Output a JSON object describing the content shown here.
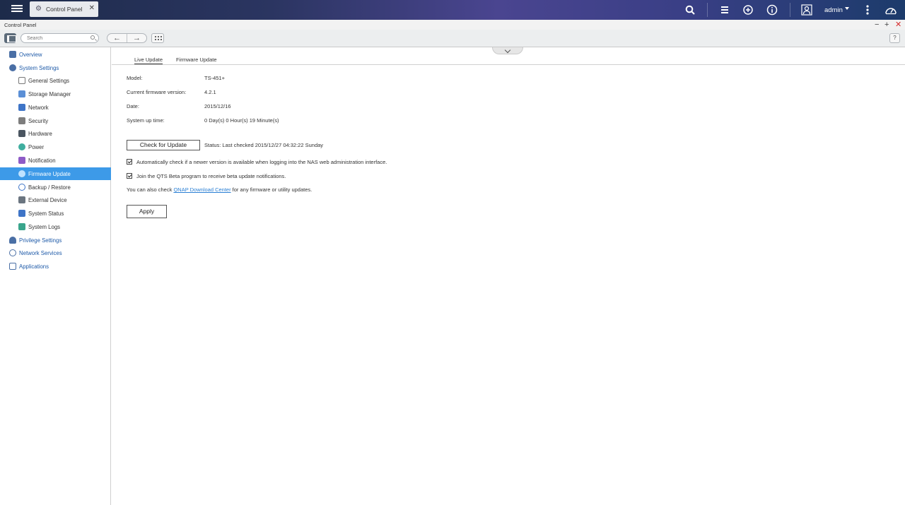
{
  "taskbar": {
    "tab_label": "Control Panel",
    "user_name": "admin"
  },
  "window": {
    "title": "Control Panel"
  },
  "toolbar": {
    "search_placeholder": "Search",
    "help_label": "?"
  },
  "sidebar": {
    "items": [
      {
        "label": "Overview"
      },
      {
        "label": "System Settings"
      },
      {
        "label": "General Settings"
      },
      {
        "label": "Storage Manager"
      },
      {
        "label": "Network"
      },
      {
        "label": "Security"
      },
      {
        "label": "Hardware"
      },
      {
        "label": "Power"
      },
      {
        "label": "Notification"
      },
      {
        "label": "Firmware Update"
      },
      {
        "label": "Backup / Restore"
      },
      {
        "label": "External Device"
      },
      {
        "label": "System Status"
      },
      {
        "label": "System Logs"
      },
      {
        "label": "Privilege Settings"
      },
      {
        "label": "Network Services"
      },
      {
        "label": "Applications"
      }
    ],
    "active": "Firmware Update"
  },
  "main": {
    "tabs": [
      {
        "label": "Live Update"
      },
      {
        "label": "Firmware Update"
      }
    ],
    "info": {
      "model_label": "Model:",
      "model_value": "TS-451+",
      "fw_label": "Current firmware version:",
      "fw_value": "4.2.1",
      "date_label": "Date:",
      "date_value": "2015/12/16",
      "uptime_label": "System up time:",
      "uptime_value": "0 Day(s) 0 Hour(s) 19 Minute(s)"
    },
    "check_button": "Check for Update",
    "status": "Status: Last checked 2015/12/27 04:32:22 Sunday",
    "options": {
      "auto_check": "Automatically check if a newer version is available when logging into the NAS web administration interface.",
      "beta": "Join the QTS Beta program to receive beta update notifications."
    },
    "note_prefix": "You can also check ",
    "note_link": "QNAP Download Center",
    "note_suffix": " for any firmware or utility updates.",
    "apply_button": "Apply"
  },
  "colors": {
    "accent": "#3d9ae8",
    "link": "#1e5aa8"
  }
}
